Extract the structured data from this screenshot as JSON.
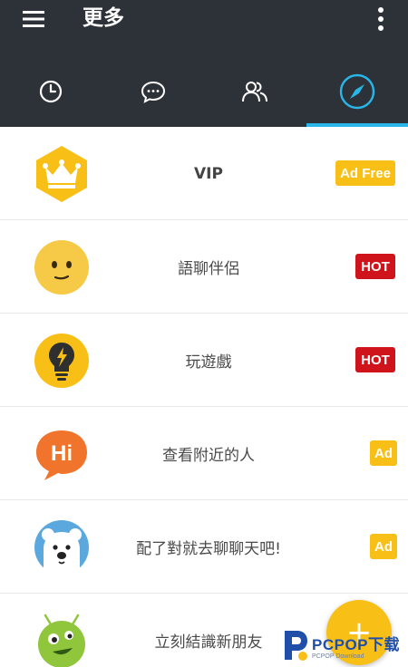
{
  "app": {
    "title": "更多"
  },
  "tabs": [
    {
      "name": "recent",
      "icon": "clock-icon"
    },
    {
      "name": "chats",
      "icon": "chat-bubble-icon"
    },
    {
      "name": "friends",
      "icon": "people-icon"
    },
    {
      "name": "discover",
      "icon": "compass-icon",
      "selected": true
    }
  ],
  "accent_color": "#29b6e8",
  "items": [
    {
      "label": "VIP",
      "badge": "Ad Free",
      "icon": "crown-icon"
    },
    {
      "label": "語聊伴侶",
      "badge": "HOT",
      "icon": "smiley-face-icon"
    },
    {
      "label": "玩遊戲",
      "badge": "HOT",
      "icon": "lightbulb-icon"
    },
    {
      "label": "查看附近的人",
      "badge": "Ad",
      "icon": "hi-bubble-icon"
    },
    {
      "label": "配了對就去聊聊天吧!",
      "badge": "Ad",
      "icon": "polar-bear-icon"
    },
    {
      "label": "立刻結識新朋友",
      "badge": "",
      "icon": "green-monster-icon"
    }
  ],
  "fab": {
    "label": "+"
  },
  "watermark": {
    "main": "PCPOP下载",
    "sub": "PCPOP Download"
  }
}
